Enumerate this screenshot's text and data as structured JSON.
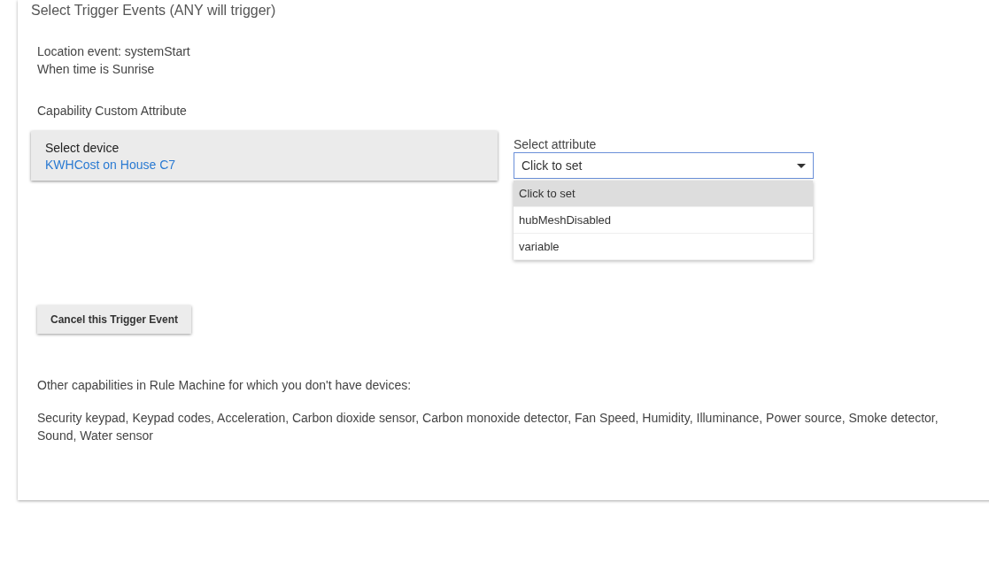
{
  "title": "Select Trigger Events (ANY will trigger)",
  "events": [
    "Location event: systemStart",
    "When time is Sunrise"
  ],
  "capability_heading": "Capability Custom Attribute",
  "device": {
    "label": "Select device",
    "value": "KWHCost on House C7"
  },
  "attribute": {
    "label": "Select attribute",
    "value": "Click to set",
    "expanded": true,
    "options": [
      {
        "label": "Click to set",
        "selected": true
      },
      {
        "label": "hubMeshDisabled",
        "selected": false
      },
      {
        "label": "variable",
        "selected": false
      }
    ]
  },
  "cancel_button": "Cancel this Trigger Event",
  "other_heading": "Other capabilities in Rule Machine for which you don't have devices:",
  "other_list": "Security keypad, Keypad codes, Acceleration, Carbon dioxide sensor, Carbon monoxide detector, Fan Speed, Humidity, Illuminance, Power source, Smoke detector, Sound, Water sensor"
}
